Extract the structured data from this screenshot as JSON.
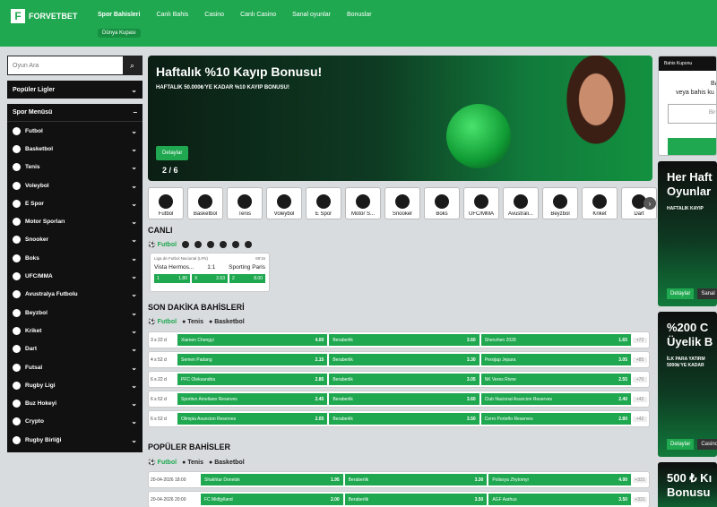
{
  "header": {
    "logo": "FORVETBET",
    "nav": [
      "Spor Bahisleri",
      "Canlı Bahis",
      "Casino",
      "Canlı Casino",
      "Sanal oyunlar",
      "Bonuslar"
    ],
    "subnav": "Dünya Kupası"
  },
  "sidebar": {
    "search_placeholder": "Oyun Ara",
    "populer_title": "Popüler Ligler",
    "menu_title": "Spor Menüsü",
    "items": [
      "Futbol",
      "Basketbol",
      "Tenis",
      "Voleybol",
      "E Spor",
      "Motor Sporları",
      "Snooker",
      "Boks",
      "UFC/MMA",
      "Avustralya Futbolu",
      "Beyzbol",
      "Kriket",
      "Dart",
      "Futsal",
      "Rugby Ligi",
      "Buz Hokeyi",
      "Crypto",
      "Rugby Birliği"
    ]
  },
  "hero": {
    "title": "Haftalık %10 Kayıp Bonusu!",
    "subtitle": "HAFTALIK 50.000₺'YE KADAR %10 KAYIP BONUSU!",
    "button": "Detaylar",
    "pager": "2 / 6"
  },
  "sports_strip": [
    "Futbol",
    "Basketbol",
    "Tenis",
    "Voleybol",
    "E Spor",
    "Motor S...",
    "Snooker",
    "Boks",
    "UFC/MMA",
    "Avustrali...",
    "Beyzbol",
    "Kriket",
    "Dart"
  ],
  "canli": {
    "title": "CANLI",
    "filter_label": "Futbol",
    "match": {
      "league": "Liga de Futbol Nacional (LFN)",
      "time": "69'15",
      "home": "Vista Hermos...",
      "score": "1:1",
      "away": "Sporting Paris",
      "odds": [
        [
          "1",
          "1.80"
        ],
        [
          "X",
          "2.63"
        ],
        [
          "2",
          "8.00"
        ]
      ]
    }
  },
  "son_dakika": {
    "title": "SON DAKİKA BAHİSLERİ",
    "filters": [
      "Futbol",
      "Tenis",
      "Basketbol"
    ],
    "rows": [
      {
        "time": "3 s 22 d",
        "home": "Xiamen Chengyi",
        "h": "4.00",
        "draw": "Beraberlik",
        "d": "3.60",
        "away": "Shenzhen 2028",
        "a": "1.65",
        "more": "+72"
      },
      {
        "time": "4 s 52 d",
        "home": "Semen Padang",
        "h": "2.15",
        "draw": "Beraberlik",
        "d": "3.30",
        "away": "Persijap Jepara",
        "a": "3.05",
        "more": "+85"
      },
      {
        "time": "6 s 22 d",
        "home": "PFC Oleksandria",
        "h": "2.85",
        "draw": "Beraberlik",
        "d": "3.05",
        "away": "NK Veres Rivne",
        "a": "2.55",
        "more": "+70"
      },
      {
        "time": "6 s 52 d",
        "home": "Sportivo Ameliano Reserves",
        "h": "2.45",
        "draw": "Beraberlik",
        "d": "3.60",
        "away": "Club Nacional Asuncion Reserves",
        "a": "2.40",
        "more": "+42"
      },
      {
        "time": "6 s 52 d",
        "home": "Olimpia Asuncion Reserves",
        "h": "2.05",
        "draw": "Beraberlik",
        "d": "3.50",
        "away": "Cerro Porteño Reserves",
        "a": "2.80",
        "more": "+42"
      }
    ]
  },
  "populer": {
    "title": "POPÜLER BAHİSLER",
    "filters": [
      "Futbol",
      "Tenis",
      "Basketbol"
    ],
    "rows": [
      {
        "time": "20-04-2026 18:00",
        "home": "Shakhtar Donetsk",
        "h": "1.95",
        "draw": "Beraberlik",
        "d": "3.30",
        "away": "Polissya Zhytomyr",
        "a": "4.00",
        "more": "+331"
      },
      {
        "time": "20-04-2026 20:00",
        "home": "FC Midtjylland",
        "h": "2.00",
        "draw": "Beraberlik",
        "d": "3.50",
        "away": "AGF Aarhus",
        "a": "3.50",
        "more": "+331"
      }
    ]
  },
  "right": {
    "kupon_title": "Bahis Kuponu",
    "kupon_t1": "Ba",
    "kupon_t2": "veya bahis ku",
    "kupon_input": "Bir",
    "promo1_title": "Her Haft Oyunlar",
    "promo1_sub": "HAFTALIK KAYIP",
    "promo1_btns": [
      "Detaylar",
      "Sanal"
    ],
    "promo2_title": "%200 C Üyelik B",
    "promo2_sub": "İLK PARA YATIRM 5000₺'YE KADAR",
    "promo2_btns": [
      "Detaylar",
      "Casino"
    ],
    "promo3_title": "500 ₺ Kı Bonusu"
  },
  "colors": {
    "brand": "#1fa84f",
    "dark": "#111111"
  }
}
